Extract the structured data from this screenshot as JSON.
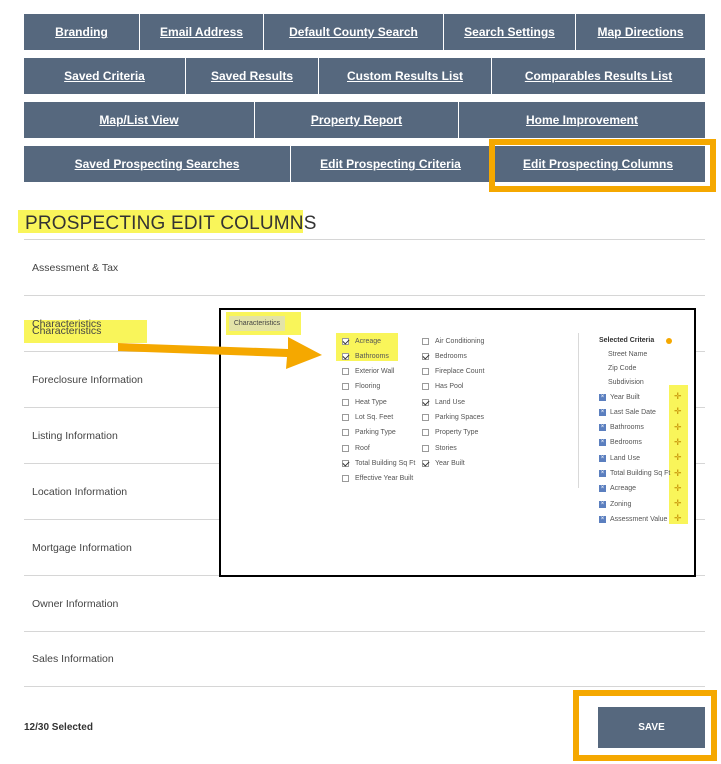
{
  "nav": {
    "row1": [
      "Branding",
      "Email Address",
      "Default County Search",
      "Search Settings",
      "Map Directions"
    ],
    "row2": [
      "Saved Criteria",
      "Saved Results",
      "Custom Results List",
      "Comparables Results List"
    ],
    "row3": [
      "Map/List View",
      "Property Report",
      "Home Improvement"
    ],
    "row4": [
      "Saved Prospecting Searches",
      "Edit Prospecting Criteria",
      "Edit Prospecting Columns"
    ]
  },
  "page": {
    "title": "PROSPECTING EDIT COLUMNS"
  },
  "categories": [
    "Assessment & Tax",
    "Characteristics",
    "Foreclosure Information",
    "Listing Information",
    "Location Information",
    "Mortgage Information",
    "Owner Information",
    "Sales Information"
  ],
  "footer": {
    "selected_count": "12/30 Selected",
    "save_label": "SAVE"
  },
  "popup": {
    "header": "Characteristics",
    "col1": [
      {
        "label": "Acreage",
        "checked": true
      },
      {
        "label": "Bathrooms",
        "checked": true
      },
      {
        "label": "Exterior Wall",
        "checked": false
      },
      {
        "label": "Flooring",
        "checked": false
      },
      {
        "label": "Heat Type",
        "checked": false
      },
      {
        "label": "Lot Sq. Feet",
        "checked": false
      },
      {
        "label": "Parking Type",
        "checked": false
      },
      {
        "label": "Roof",
        "checked": false
      },
      {
        "label": "Total Building Sq Ft",
        "checked": true
      },
      {
        "label": "Effective Year Built",
        "checked": false
      }
    ],
    "col2": [
      {
        "label": "Air Conditioning",
        "checked": false
      },
      {
        "label": "Bedrooms",
        "checked": true
      },
      {
        "label": "Fireplace Count",
        "checked": false
      },
      {
        "label": "Has Pool",
        "checked": false
      },
      {
        "label": "Land Use",
        "checked": true
      },
      {
        "label": "Parking Spaces",
        "checked": false
      },
      {
        "label": "Property Type",
        "checked": false
      },
      {
        "label": "Stories",
        "checked": false
      },
      {
        "label": "Year Built",
        "checked": true
      }
    ],
    "selected_title": "Selected Criteria",
    "fixed_criteria": [
      "Street Name",
      "Zip Code",
      "Subdivision"
    ],
    "selected_criteria": [
      "Year Built",
      "Last Sale Date",
      "Bathrooms",
      "Bedrooms",
      "Land Use",
      "Total Building Sq Ft",
      "Acreage",
      "Zoning",
      "Assessment Value"
    ]
  },
  "colors": {
    "nav_bg": "#56687e",
    "highlight_yellow": "#f9f55a",
    "highlight_orange": "#f5a800"
  }
}
